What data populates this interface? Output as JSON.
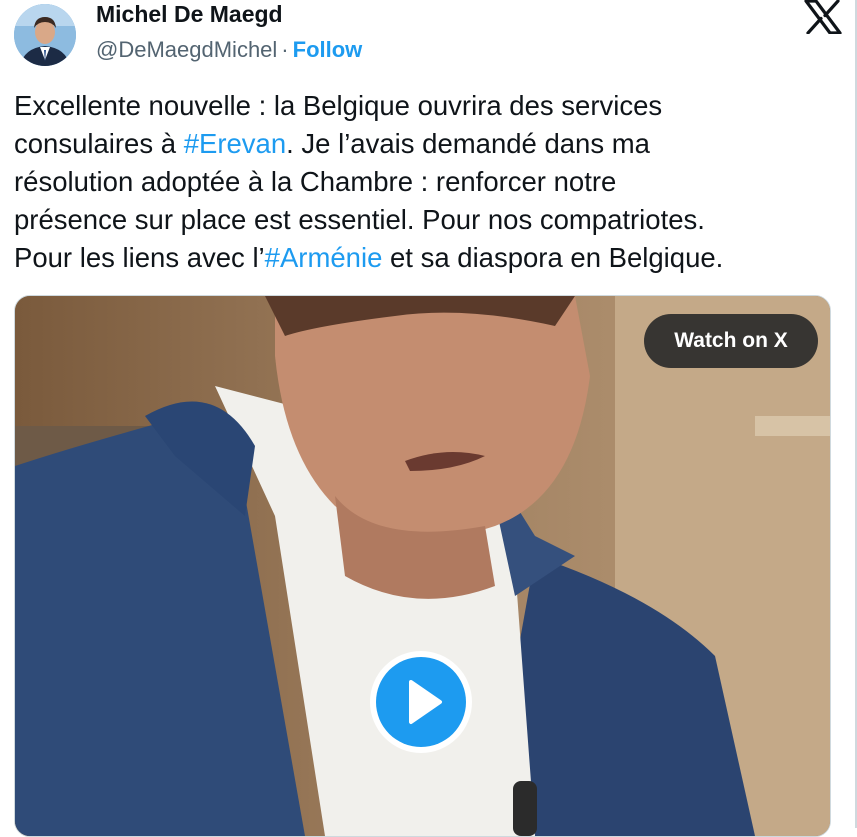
{
  "author": {
    "name": "Michel De Maegd",
    "handle": "@DeMaegdMichel",
    "separator": "·",
    "follow_label": "Follow"
  },
  "brand_icon": "x-logo-icon",
  "tweet": {
    "lines": [
      [
        {
          "t": "Excellente nouvelle : la Belgique ouvrira des services"
        }
      ],
      [
        {
          "t": "consulaires à "
        },
        {
          "t": "#Erevan",
          "tag": true
        },
        {
          "t": ". Je l’avais demandé dans ma"
        }
      ],
      [
        {
          "t": "résolution adoptée à la Chambre : renforcer notre"
        }
      ],
      [
        {
          "t": "présence sur place est essentiel. Pour nos compatriotes."
        }
      ],
      [
        {
          "t": "Pour les liens avec l’"
        },
        {
          "t": "#Arménie",
          "tag": true
        },
        {
          "t": " et sa diaspora en Belgique."
        }
      ]
    ]
  },
  "media": {
    "watch_label": "Watch on X",
    "play_icon": "play-icon"
  },
  "colors": {
    "link": "#1d9bf0",
    "text": "#0f1419",
    "secondary": "#536471",
    "overlay": "#0f1419"
  }
}
